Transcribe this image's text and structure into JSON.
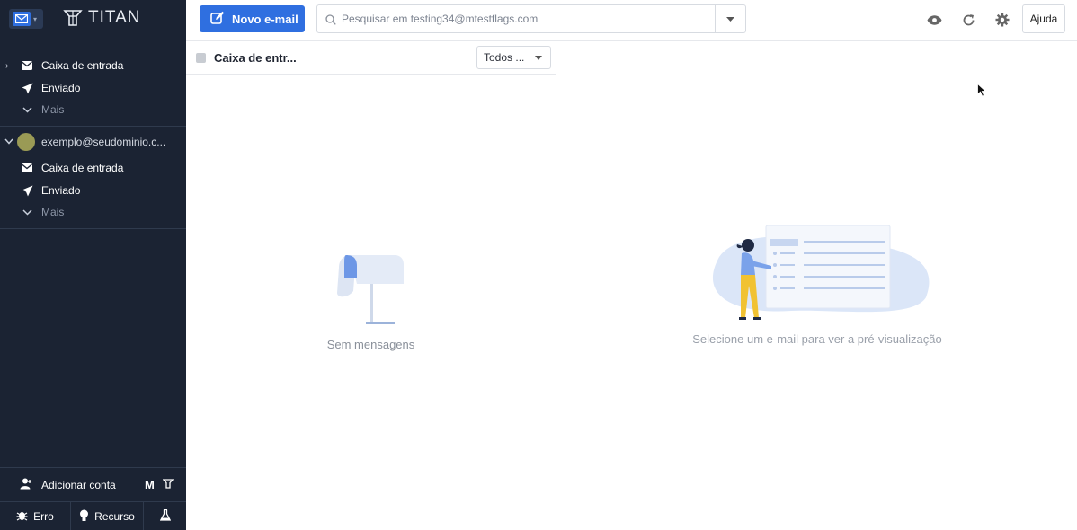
{
  "brand": {
    "name": "TITAN"
  },
  "sidebar": {
    "account1_folders": [
      {
        "label": "Caixa de entrada",
        "icon": "inbox-icon"
      },
      {
        "label": "Enviado",
        "icon": "send-icon"
      },
      {
        "label": "Mais",
        "icon": "chevron-down-icon"
      }
    ],
    "account2": {
      "email": "exemplo@seudominio.c..."
    },
    "account2_folders": [
      {
        "label": "Caixa de entrada",
        "icon": "inbox-icon"
      },
      {
        "label": "Enviado",
        "icon": "send-icon"
      },
      {
        "label": "Mais",
        "icon": "chevron-down-icon"
      }
    ],
    "add_account": "Adicionar conta",
    "bottom": {
      "bug": "Erro",
      "feature": "Recurso"
    }
  },
  "toolbar": {
    "compose_label": "Novo e-mail",
    "search_placeholder": "Pesquisar em testing34@mtestflags.com",
    "help_label": "Ajuda"
  },
  "list": {
    "title": "Caixa de entr...",
    "filter": "Todos ...",
    "empty": "Sem mensagens"
  },
  "preview": {
    "empty": "Selecione um e-mail para ver a pré-visualização"
  },
  "colors": {
    "accent": "#2f6fe0",
    "sidebar_bg": "#1b2333"
  }
}
